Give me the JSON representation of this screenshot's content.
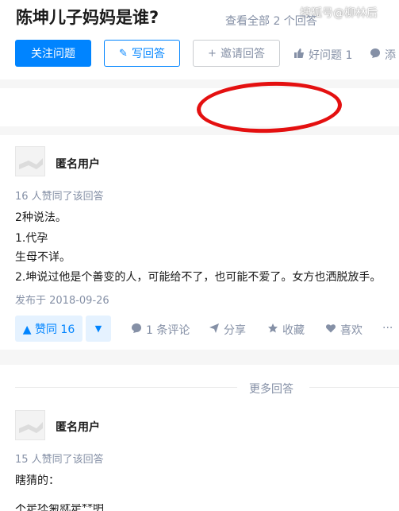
{
  "question": {
    "title": "陈坤儿子妈妈是谁?",
    "watermark": "搜狐号@柳林后"
  },
  "actions": {
    "follow": "关注问题",
    "write": "写回答",
    "invite": "邀请回答",
    "good_question": "好问题 1",
    "comment_partial": "添"
  },
  "view_all": "查看全部 2 个回答",
  "highlight_color": "#e41010",
  "answers": [
    {
      "author": "匿名用户",
      "votes_text": "16 人赞同了该回答",
      "lines": [
        "2种说法。",
        "1.代孕",
        "生母不详。",
        "2.坤说过他是个善变的人，可能给不了，也可能不爱了。女方也洒脱放手。"
      ],
      "date": "发布于 2018-09-26",
      "upvote": "▲ 赞同 16",
      "downvote": "▼",
      "comments": "1 条评论",
      "share": "分享",
      "collect": "收藏",
      "like": "喜欢",
      "more": "···"
    },
    {
      "author": "匿名用户",
      "votes_text": "15 人赞同了该回答",
      "lines": [
        "瞎猜的：",
        "不是坯菊就是**明"
      ]
    }
  ],
  "more_answers": "更多回答",
  "icons": {
    "write": "pencil-icon",
    "invite": "add-person-icon",
    "good_question": "thumbs-up-icon",
    "comment": "comment-icon",
    "share": "paper-plane-icon",
    "collect": "star-icon",
    "like": "heart-icon"
  }
}
